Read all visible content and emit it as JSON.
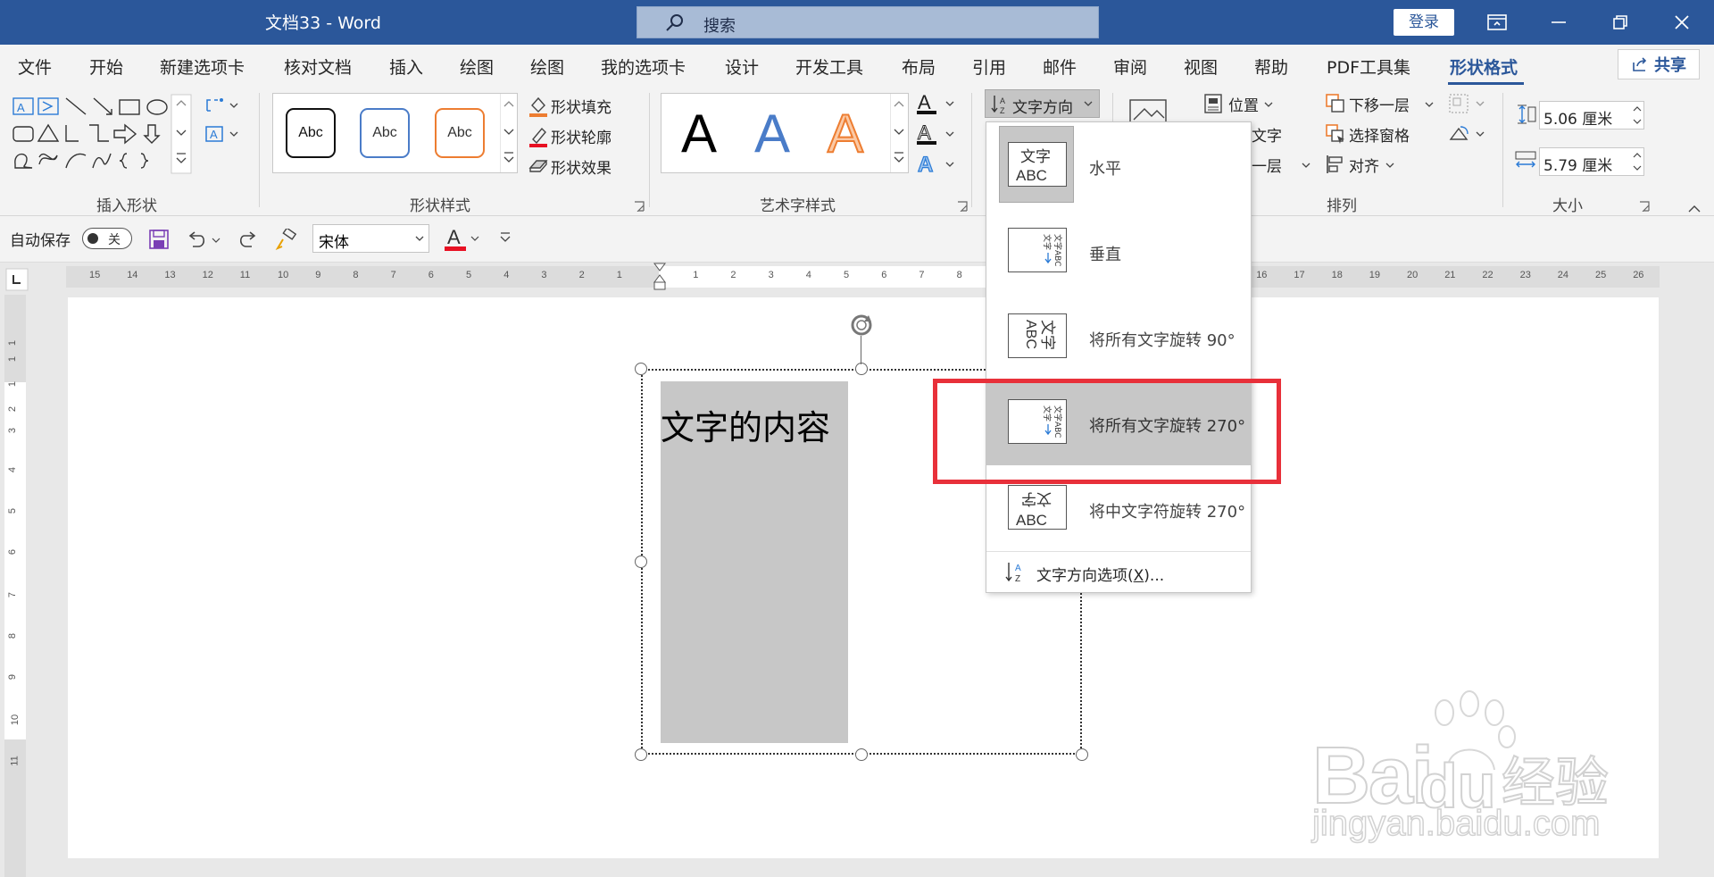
{
  "titlebar": {
    "title": "文档33  -  Word",
    "search_placeholder": "搜索",
    "login_label": "登录",
    "bg_color": "#2b579a"
  },
  "tabs": [
    "文件",
    "开始",
    "新建选项卡",
    "核对文档",
    "插入",
    "绘图",
    "绘图",
    "我的选项卡",
    "设计",
    "开发工具",
    "布局",
    "引用",
    "邮件",
    "审阅",
    "视图",
    "帮助",
    "PDF工具集",
    "形状格式"
  ],
  "active_tab": "形状格式",
  "share_label": "共享",
  "ribbon": {
    "groups": {
      "insert_shapes": "插入形状",
      "shape_styles": "形状样式",
      "wordart_styles": "艺术字样式",
      "arrange": "排列",
      "size": "大小"
    },
    "style_samples": [
      "Abc",
      "Abc",
      "Abc"
    ],
    "wordart_samples": [
      "A",
      "A",
      "A"
    ],
    "shape_fill": "形状填充",
    "shape_outline": "形状轮廓",
    "shape_effects": "形状效果",
    "text_direction": "文字方向",
    "position": "位置",
    "wrap_text_partial": "环绕文字",
    "bring_forward_partial": "上移一层",
    "send_backward": "下移一层",
    "selection_pane": "选择窗格",
    "align": "对齐",
    "height_value": "5.06 厘米",
    "width_value": "5.79 厘米"
  },
  "qat": {
    "autosave_label": "自动保存",
    "autosave_state": "关",
    "font_name": "宋体"
  },
  "ruler": {
    "h_left": [
      "15",
      "14",
      "13",
      "12",
      "11",
      "10",
      "9",
      "8",
      "7",
      "6",
      "5",
      "4",
      "3",
      "2",
      "1"
    ],
    "h_right": [
      "1",
      "2",
      "3",
      "4",
      "5",
      "6",
      "7",
      "8"
    ],
    "h_far": [
      "16",
      "17",
      "18",
      "19",
      "20",
      "21",
      "22",
      "23",
      "24",
      "25",
      "26"
    ],
    "v": [
      "1",
      "1",
      "1",
      "2",
      "3",
      "4",
      "5",
      "6",
      "7",
      "8",
      "9",
      "10",
      "11"
    ]
  },
  "document": {
    "shape_text": "文字的内容"
  },
  "text_direction_menu": {
    "items": [
      {
        "label": "水平",
        "icon_text": [
          "文字",
          "ABC"
        ]
      },
      {
        "label": "垂直",
        "icon_text": [
          "文字ABC"
        ]
      },
      {
        "label": "将所有文字旋转 90°",
        "icon_text": [
          "文字",
          "ABC"
        ]
      },
      {
        "label": "将所有文字旋转 270°",
        "icon_text": [
          "文字ABC"
        ]
      },
      {
        "label": "将中文字符旋转 270°",
        "icon_text": [
          "文字",
          "ABC"
        ]
      }
    ],
    "options_label": "文字方向选项(",
    "options_key": "X",
    "options_suffix": ")...",
    "highlight_color": "#e8303a"
  },
  "watermark": {
    "brand": "Bai",
    "brand_cn": "经验",
    "url": "jingyan.baidu.com"
  }
}
